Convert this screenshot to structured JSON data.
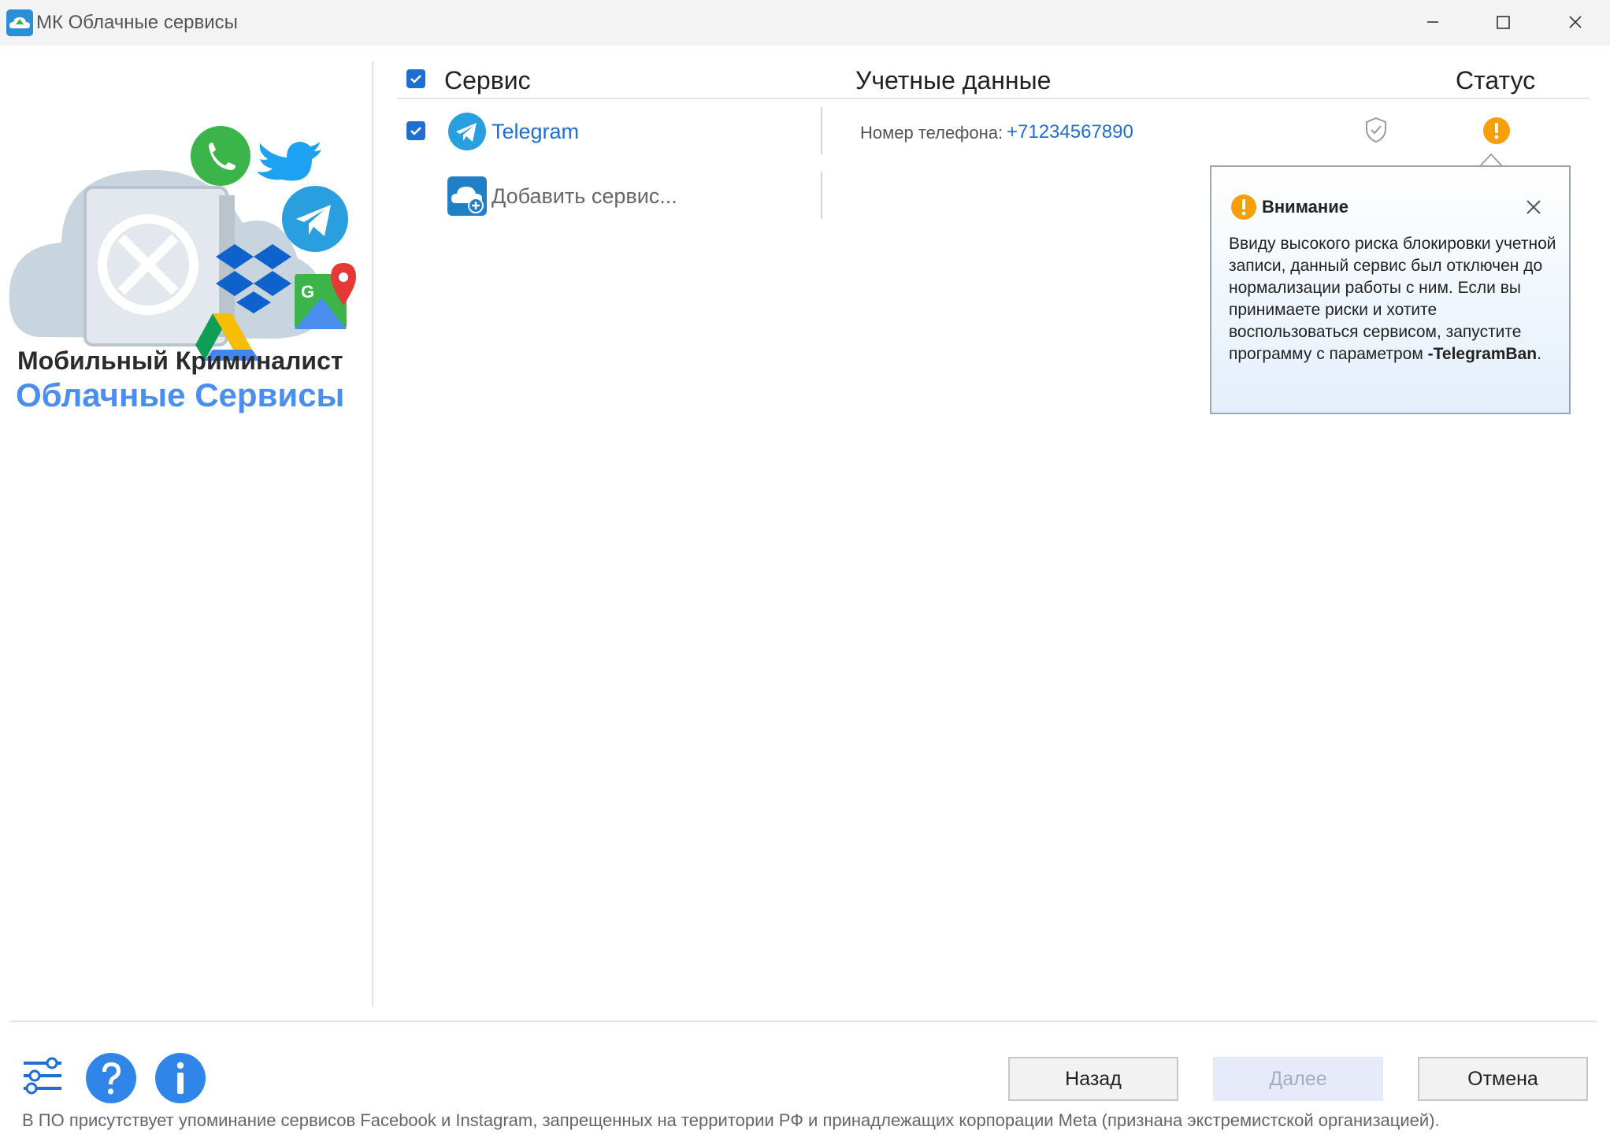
{
  "window": {
    "title": "МК Облачные сервисы"
  },
  "sidebar": {
    "brand_line1": "Мобильный Криминалист",
    "brand_line2": "Облачные Сервисы"
  },
  "table": {
    "columns": {
      "service": "Сервис",
      "credentials": "Учетные данные",
      "status": "Статус"
    },
    "rows": [
      {
        "service": "Telegram",
        "checked": true,
        "credential_label": "Номер телефона:",
        "credential_value": "+71234567890",
        "icons": [
          "telegram-icon",
          "shield-icon",
          "warning-icon"
        ]
      }
    ],
    "add_service_label": "Добавить сервис..."
  },
  "tooltip": {
    "title": "Внимание",
    "body": "Ввиду высокого риска блокировки учетной записи, данный сервис был отключен до нормализации работы с ним. Если вы принимаете риски и хотите воспользоваться сервисом, запустите программу с параметром",
    "param": "-TelegramBan",
    "param_suffix": "."
  },
  "buttons": {
    "back": "Назад",
    "next": "Далее",
    "cancel": "Отмена"
  },
  "footer": {
    "note": "В ПО присутствует упоминание сервисов Facebook и Instagram, запрещенных на территории РФ и принадлежащих корпорации Meta (признана экстремистской организацией)."
  },
  "colors": {
    "accent": "#1f6fd1",
    "brand_blue": "#4a8ef0",
    "warning": "#f5a00a",
    "disabled_button": "#e6eaf9"
  }
}
